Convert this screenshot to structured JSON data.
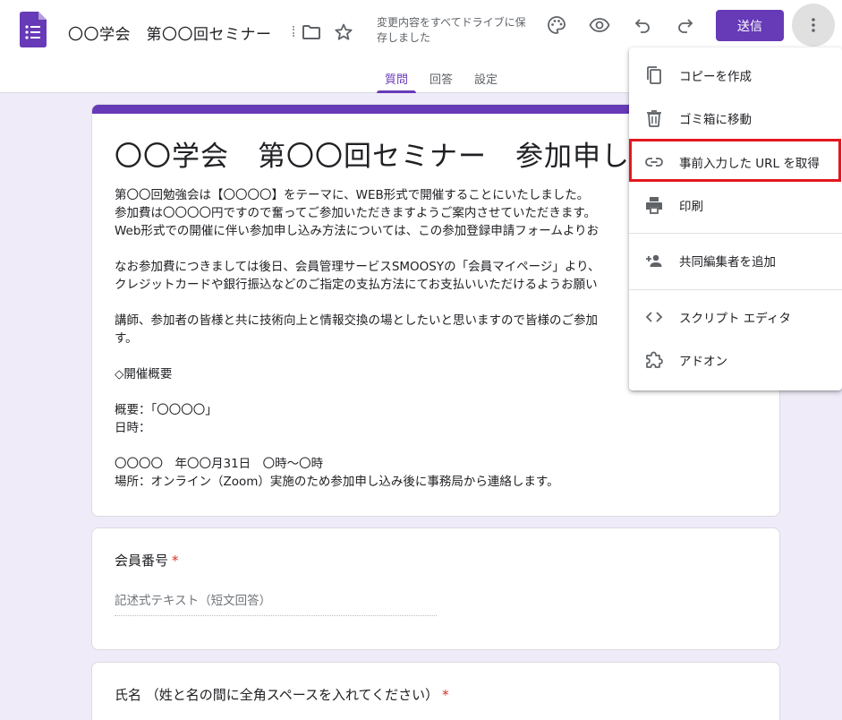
{
  "header": {
    "doc_title": "〇〇学会　第〇〇回セミナー",
    "save_status": "変更内容をすべてドライブに保存しました",
    "send_label": "送信"
  },
  "tabs": [
    {
      "label": "質問",
      "active": true
    },
    {
      "label": "回答",
      "active": false
    },
    {
      "label": "設定",
      "active": false
    }
  ],
  "form": {
    "title": "〇〇学会　第〇〇回セミナー　参加申し",
    "description": "第〇〇回勉強会は【〇〇〇〇】をテーマに、WEB形式で開催することにいたしました。\n参加費は〇〇〇〇円ですので奮ってご参加いただきますようご案内させていただきます。\nWeb形式での開催に伴い参加申し込み方法については、この参加登録申請フォームよりお\n\nなお参加費につきましては後日、会員管理サービスSMOOSYの「会員マイページ」より、\nクレジットカードや銀行振込などのご指定の支払方法にてお支払いいただけるようお願い\n\n講師、参加者の皆様と共に技術向上と情報交換の場としたいと思いますので皆様のご参加\nす。\n\n◇開催概要\n\n概要：「〇〇〇〇」\n日時：\n\n〇〇〇〇　年〇〇月31日　〇時～〇時\n場所：オンライン（Zoom）実施のため参加申し込み後に事務局から連絡します。"
  },
  "questions": [
    {
      "title": "会員番号",
      "required_mark": "*",
      "placeholder": "記述式テキスト（短文回答）"
    },
    {
      "title": "氏名 （姓と名の間に全角スペースを入れてください）",
      "required_mark": "*"
    }
  ],
  "menu": {
    "items": [
      {
        "label": "コピーを作成",
        "icon": "copy-icon"
      },
      {
        "label": "ゴミ箱に移動",
        "icon": "trash-icon"
      },
      {
        "label": "事前入力した URL を取得",
        "icon": "link-icon",
        "highlighted": true
      },
      {
        "label": "印刷",
        "icon": "print-icon"
      },
      {
        "label": "共同編集者を追加",
        "icon": "add-person-icon"
      },
      {
        "label": "スクリプト エディタ",
        "icon": "code-icon"
      },
      {
        "label": "アドオン",
        "icon": "puzzle-icon"
      }
    ]
  },
  "colors": {
    "accent": "#673ab7",
    "background": "#f0ebf8",
    "highlight": "#e3171f",
    "required": "#d93025"
  }
}
